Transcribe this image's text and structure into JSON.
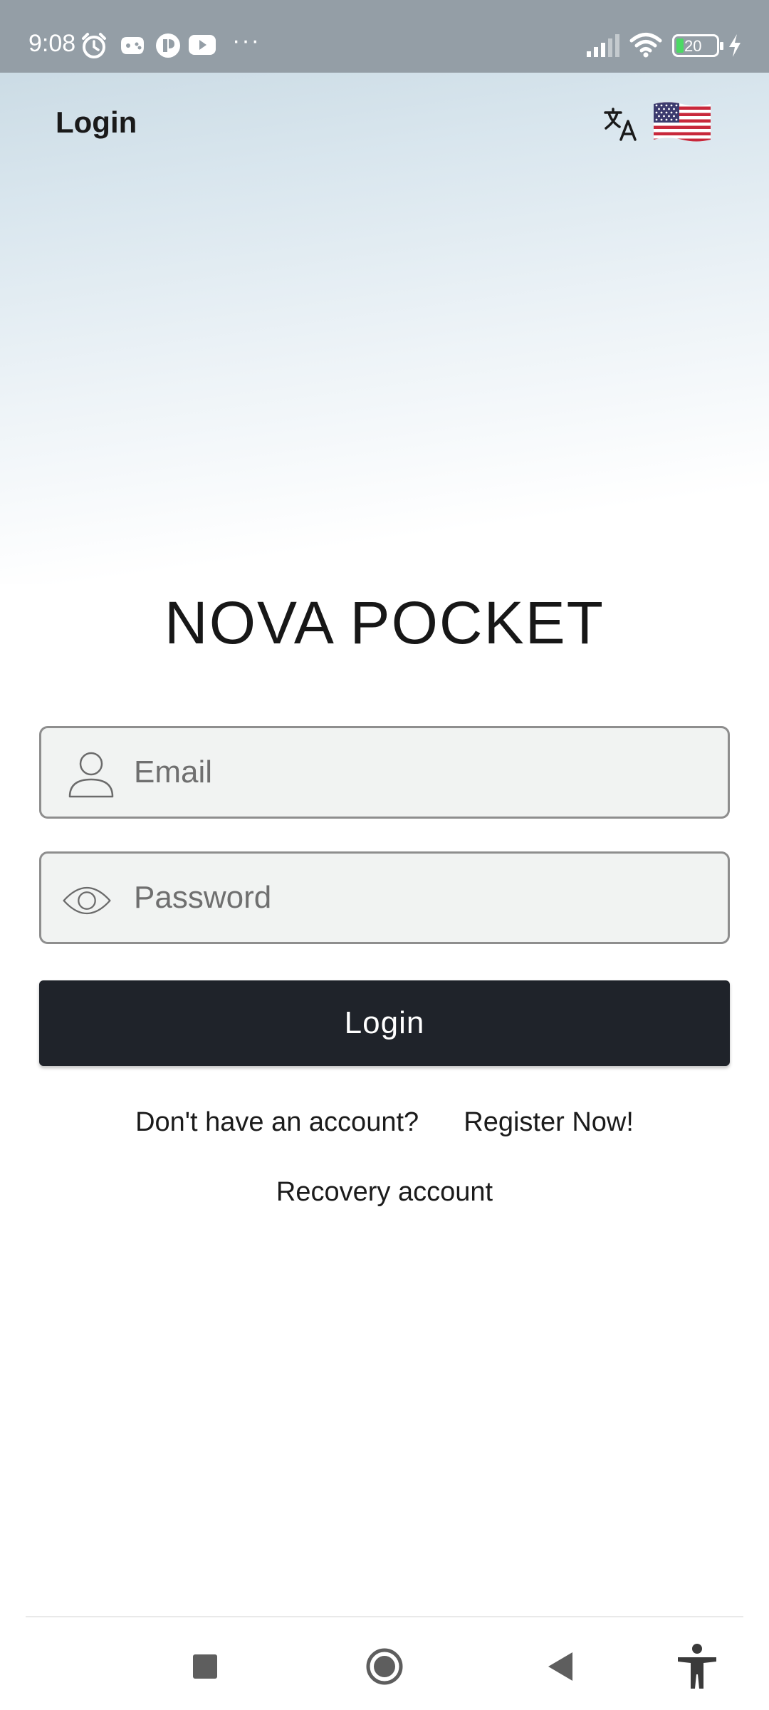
{
  "status_bar": {
    "time": "9:08",
    "battery": "20",
    "icons": [
      "alarm-icon",
      "game-icon",
      "notification-icon",
      "youtube-icon",
      "more-icon",
      "signal-icon",
      "wifi-icon",
      "battery-icon",
      "charging-icon"
    ],
    "more": "···"
  },
  "app_bar": {
    "title": "Login",
    "translate_icon": "translate-icon",
    "flag_icon": "us-flag-icon"
  },
  "brand": "NOVA POCKET",
  "form": {
    "email_placeholder": "Email",
    "email_value": "",
    "password_placeholder": "Password",
    "password_value": "",
    "login_label": "Login"
  },
  "links": {
    "no_account": "Don't have an account?",
    "register": "Register Now!",
    "recovery": "Recovery account"
  },
  "nav_bar": {
    "icons": [
      "recents-square-icon",
      "home-circle-icon",
      "back-triangle-icon",
      "accessibility-icon"
    ]
  },
  "colors": {
    "status_bar": "#949ea6",
    "button": "#1f232a",
    "field_bg": "#f1f3f2",
    "field_border": "#8e8e8e"
  }
}
